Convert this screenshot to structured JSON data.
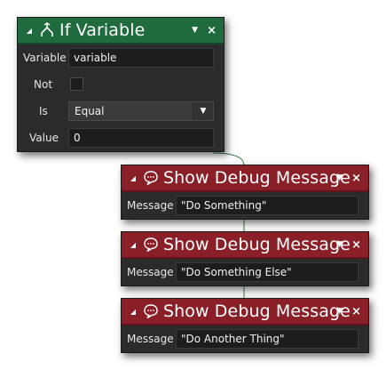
{
  "if_block": {
    "title": "If Variable",
    "icon": "if-variable-icon",
    "variable_label": "Variable",
    "variable_value": "variable",
    "not_label": "Not",
    "not_checked": false,
    "is_label": "Is",
    "is_value": "Equal",
    "value_label": "Value",
    "value_value": "0"
  },
  "debug_blocks": [
    {
      "title": "Show Debug Message",
      "icon": "speech-bubble-icon",
      "message_label": "Message",
      "message_value": "\"Do Something\""
    },
    {
      "title": "Show Debug Message",
      "icon": "speech-bubble-icon",
      "message_label": "Message",
      "message_value": "\"Do Something Else\""
    },
    {
      "title": "Show Debug Message",
      "icon": "speech-bubble-icon",
      "message_label": "Message",
      "message_value": "\"Do Another Thing\""
    }
  ],
  "colors": {
    "if_header": "#1f6b3d",
    "debug_header": "#8b1f28",
    "block_body": "#2b2b2b",
    "connector": "#3c7a4a"
  }
}
